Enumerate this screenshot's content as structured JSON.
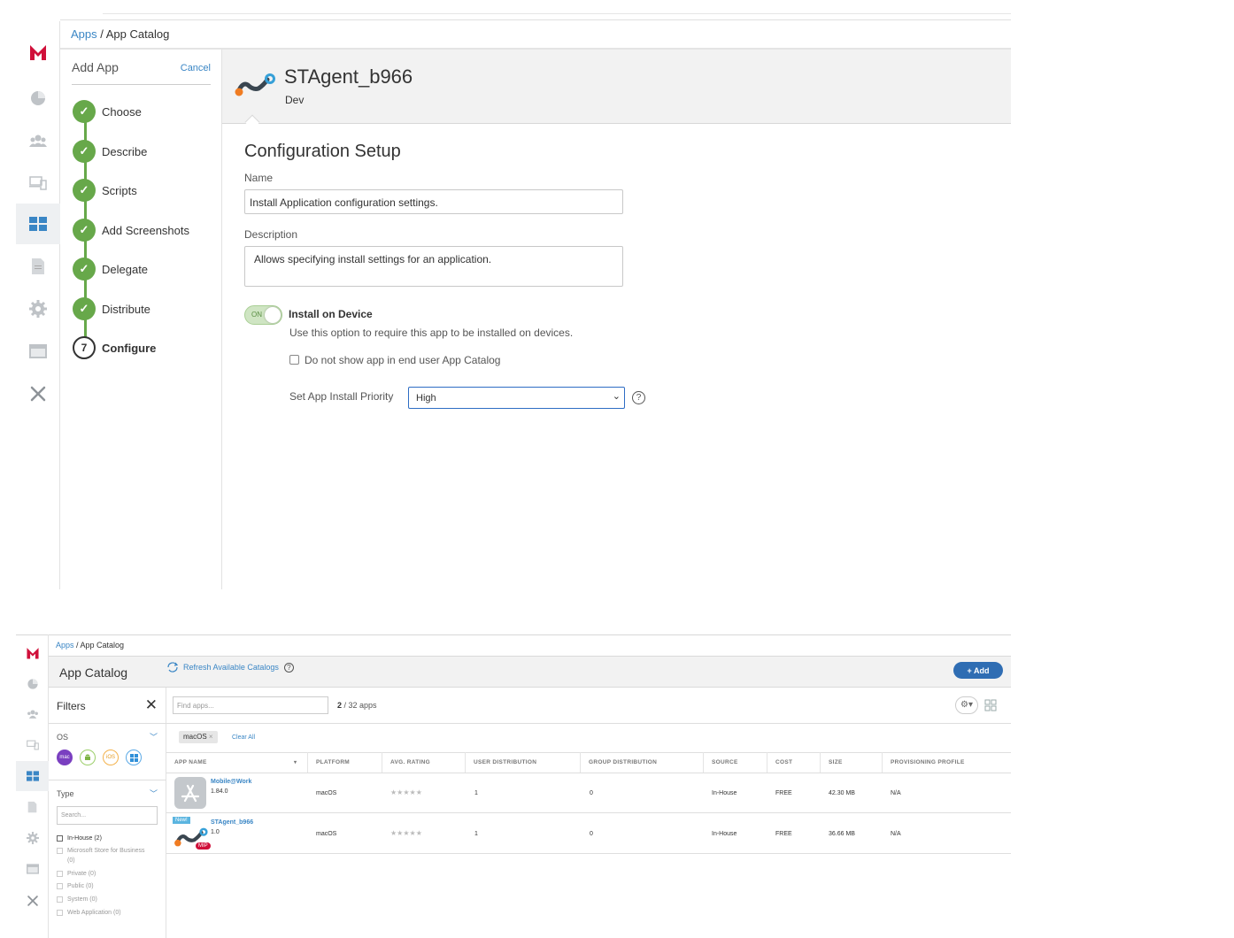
{
  "wizard_screen": {
    "breadcrumb": {
      "link": "Apps",
      "sep": " / ",
      "current": "App Catalog"
    },
    "panel_title": "Add App",
    "cancel_label": "Cancel",
    "steps": [
      {
        "label": "Choose",
        "done": true
      },
      {
        "label": "Describe",
        "done": true
      },
      {
        "label": "Scripts",
        "done": true
      },
      {
        "label": "Add Screenshots",
        "done": true
      },
      {
        "label": "Delegate",
        "done": true
      },
      {
        "label": "Distribute",
        "done": true
      },
      {
        "label": "Configure",
        "done": false,
        "number": "7"
      }
    ],
    "app": {
      "name": "STAgent_b966",
      "env": "Dev"
    },
    "config": {
      "heading": "Configuration Setup",
      "name_label": "Name",
      "name_value": "Install Application configuration settings.",
      "description_label": "Description",
      "description_value": "Allows specifying install settings for an application.",
      "toggle_state": "ON",
      "install_title": "Install on Device",
      "install_desc": "Use this option to require this app to be installed on devices.",
      "hide_label": "Do not show app in end user App Catalog",
      "priority_label": "Set App Install Priority",
      "priority_value": "High",
      "help_symbol": "?"
    }
  },
  "catalog_screen": {
    "breadcrumb": {
      "link": "Apps",
      "sep": " / ",
      "current": "App Catalog"
    },
    "title": "App Catalog",
    "refresh_label": "Refresh Available Catalogs",
    "help_symbol": "?",
    "add_label": "+  Add",
    "filters": {
      "title": "Filters",
      "os_label": "OS",
      "os_badges": [
        "mac",
        "android",
        "iOS",
        "windows"
      ],
      "type_label": "Type",
      "search_placeholder": "Search...",
      "types": [
        {
          "label": "In-House  (2)",
          "enabled": true
        },
        {
          "label": "Microsoft Store for Business  (0)",
          "enabled": false
        },
        {
          "label": "Private  (0)",
          "enabled": false
        },
        {
          "label": "Public  (0)",
          "enabled": false
        },
        {
          "label": "System  (0)",
          "enabled": false
        },
        {
          "label": "Web Application  (0)",
          "enabled": false
        }
      ]
    },
    "find_placeholder": "Find apps...",
    "count_shown": "2",
    "count_total": " / 32 apps",
    "active_chip": "macOS",
    "clear_all": "Clear All",
    "columns": [
      "APP NAME",
      "PLATFORM",
      "AVG. RATING",
      "USER DISTRIBUTION",
      "GROUP DISTRIBUTION",
      "SOURCE",
      "COST",
      "SIZE",
      "PROVISIONING PROFILE"
    ],
    "rows": [
      {
        "name": "Mobile@Work",
        "version": "1.84.0",
        "platform": "macOS",
        "rating": "★★★★★",
        "user_dist": "1",
        "group_dist": "0",
        "source": "In-House",
        "cost": "FREE",
        "size": "42.30 MB",
        "profile": "N/A",
        "badge_new": "",
        "badge_mip": ""
      },
      {
        "name": "STAgent_b966",
        "version": "1.0",
        "platform": "macOS",
        "rating": "★★★★★",
        "user_dist": "1",
        "group_dist": "0",
        "source": "In-House",
        "cost": "FREE",
        "size": "36.66 MB",
        "profile": "N/A",
        "badge_new": "New!",
        "badge_mip": "MIP"
      }
    ]
  },
  "colors": {
    "accent_blue": "#3a86c5",
    "step_green": "#67a84a",
    "add_button": "#2f6db3",
    "brand_red": "#d0103a"
  }
}
